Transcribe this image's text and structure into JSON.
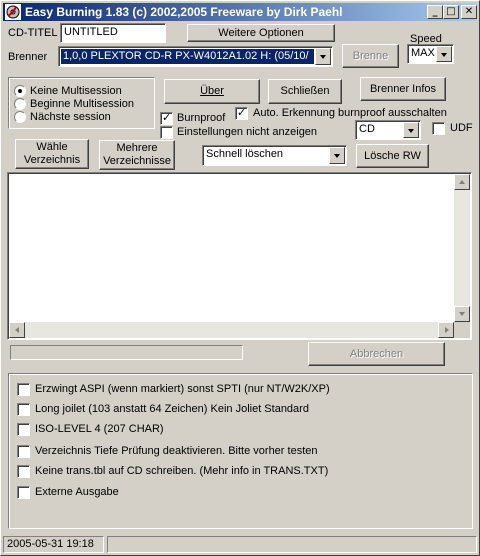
{
  "window": {
    "title": "Easy Burning 1.83 (c) 2002,2005 Freeware by Dirk Paehl",
    "minimize": "_",
    "maximize": "□",
    "close": "✕"
  },
  "cd_title": {
    "label": "CD-TITEL",
    "value": "UNTITLED"
  },
  "options_button": "Weitere Optionen",
  "speed": {
    "label": "Speed",
    "value": "MAX"
  },
  "burner": {
    "label": "Brenner",
    "value": "1,0,0 PLEXTOR CD-R   PX-W4012A1.02 H: (05/10/"
  },
  "burn_button": "Brenne",
  "session": {
    "options": [
      "Keine Multisession",
      "Beginne Multisession",
      "Nächste session"
    ],
    "selected": 0
  },
  "buttons": {
    "ueber": "Über",
    "schliessen": "Schließen",
    "brenner_infos": "Brenner Infos",
    "waehle_line1": "Wähle",
    "waehle_line2": "Verzeichnis",
    "mehrere_line1": "Mehrere",
    "mehrere_line2": "Verzeichnisse",
    "loesche_rw": "Lösche RW",
    "abbrechen": "Abbrechen"
  },
  "checks": {
    "burnproof": {
      "label": "Burnproof",
      "checked": true
    },
    "auto_burnproof": {
      "label": "Auto. Erkennung burnproof ausschalten",
      "checked": true
    },
    "einstellungen": {
      "label": "Einstellungen nicht anzeigen",
      "checked": false
    },
    "udf": {
      "label": "UDF",
      "checked": false
    }
  },
  "media_type": "CD",
  "erase_mode": "Schnell löschen",
  "options_list": [
    "Erzwingt ASPI (wenn markiert) sonst SPTI (nur NT/W2K/XP)",
    "Long joilet (103 anstatt 64 Zeichen) Kein Joliet Standard",
    "ISO-LEVEL 4 (207 CHAR)",
    "Verzeichnis Tiefe Prüfung deaktivieren. Bitte vorher testen",
    "Keine trans.tbl auf CD schreiben. (Mehr info in TRANS.TXT)",
    "Externe Ausgabe"
  ],
  "status": {
    "datetime": "2005-05-31  19:18"
  },
  "colors": {
    "titlebar_start": "#0a246a",
    "titlebar_end": "#a6caf0",
    "selection": "#0a246a",
    "face": "#d4d0c8"
  }
}
